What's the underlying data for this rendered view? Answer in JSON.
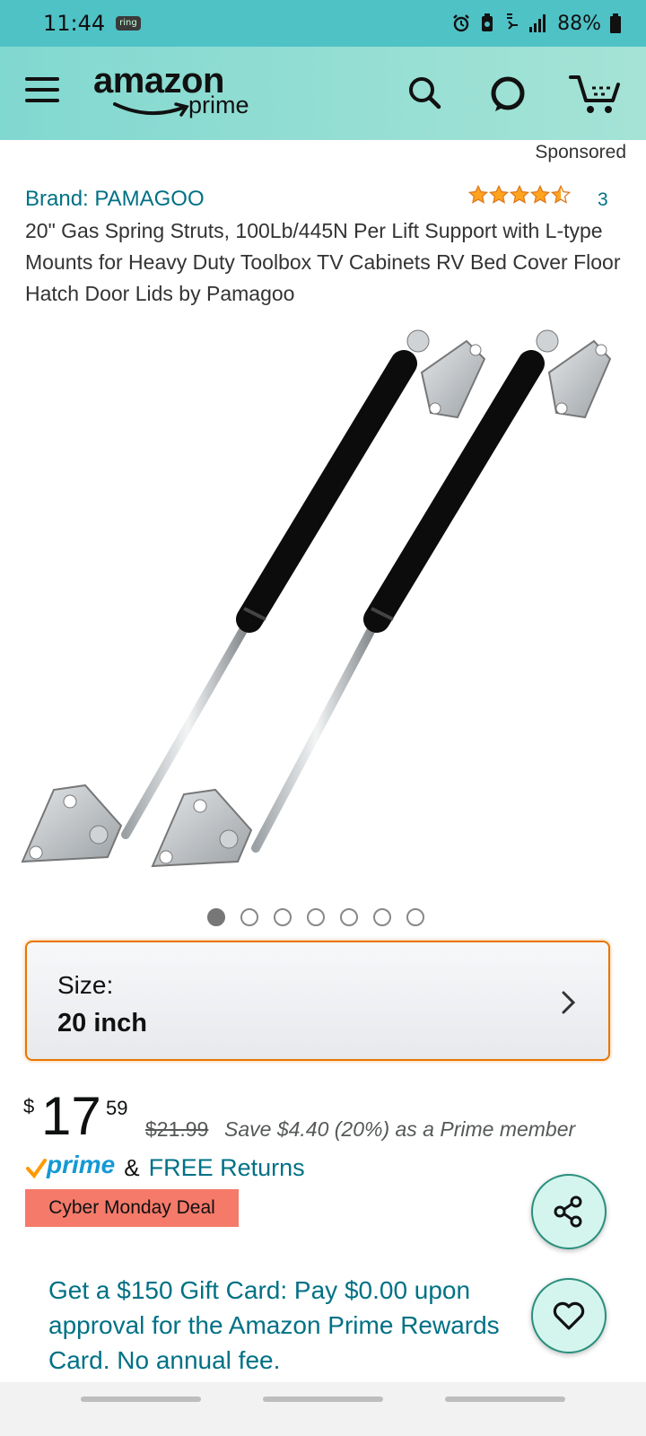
{
  "status_bar": {
    "time": "11:44",
    "ring_badge": "ring",
    "battery": "88%",
    "icons": [
      "alarm-icon",
      "battery-saver-icon",
      "wifi-calling-icon",
      "signal-icon",
      "battery-icon"
    ]
  },
  "header": {
    "logo_amazon": "amazon",
    "logo_prime": "prime",
    "icons": [
      "menu-icon",
      "search-icon",
      "alexa-icon",
      "cart-icon"
    ],
    "accent_color": "#81d8d0"
  },
  "sponsored_label": "Sponsored",
  "product": {
    "brand": "Brand: PAMAGOO",
    "rating_stars": 4.5,
    "rating_count": "3",
    "title": "20\" Gas Spring Struts, 100Lb/445N Per Lift Support with L-type Mounts for Heavy Duty Toolbox TV Cabinets RV Bed Cover Floor Hatch Door Lids by Pamagoo",
    "image_count": 7,
    "active_image": 1
  },
  "size": {
    "label": "Size:",
    "value": "20 inch"
  },
  "price": {
    "symbol": "$",
    "whole": "17",
    "fraction": "59",
    "list_price": "$21.99",
    "savings": "Save $4.40 (20%) as a Prime member"
  },
  "shipping": {
    "prime": "prime",
    "amp": "&",
    "free_returns": "FREE Returns"
  },
  "deal_badge": "Cyber Monday Deal",
  "gift_card": "Get a $150 Gift Card: Pay $0.00 upon approval for the Amazon Prime Rewards Card. No annual fee.",
  "colors": {
    "link": "#007185",
    "star": "#ffa41c",
    "deal": "#f57a6a",
    "size_border": "#e77600"
  }
}
